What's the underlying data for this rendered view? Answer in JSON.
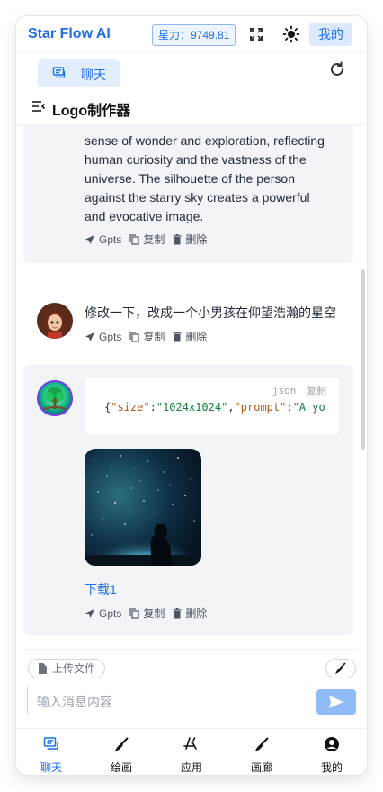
{
  "header": {
    "brand": "Star Flow AI",
    "power": "星力：9749.81",
    "mine": "我的",
    "icons": [
      "fullscreen-icon",
      "sun-icon"
    ]
  },
  "subbar": {
    "tab_label": "聊天",
    "page_title": "Logo制作器"
  },
  "messages": [
    {
      "role": "bot",
      "lines": [
        "sense of wonder and exploration, reflecting",
        "human curiosity and the vastness of the",
        "universe. The silhouette of the person",
        "against the starry sky creates a powerful",
        "and evocative image."
      ],
      "actions": [
        "Gpts",
        "复制",
        "删除"
      ]
    },
    {
      "role": "user",
      "text": "修改一下，改成一个小男孩在仰望浩瀚的星空",
      "actions": [
        "Gpts",
        "复制",
        "删除"
      ]
    },
    {
      "role": "bot",
      "code_lang": "json",
      "code_copy": "复制",
      "code_key1": "\"size\"",
      "code_val1": "\"1024x1024\"",
      "code_key2": "\"prompt\"",
      "code_val2": "\"A yo",
      "download": "下载1",
      "actions": [
        "Gpts",
        "复制",
        "删除"
      ]
    }
  ],
  "composer": {
    "upload_label": "上传文件",
    "placeholder": "输入消息内容"
  },
  "bottom_nav": [
    {
      "label": "聊天",
      "icon": "chat-icon",
      "active": true
    },
    {
      "label": "绘画",
      "icon": "brush-icon"
    },
    {
      "label": "应用",
      "icon": "apps-icon"
    },
    {
      "label": "画廊",
      "icon": "gallery-icon"
    },
    {
      "label": "我的",
      "icon": "user-icon"
    }
  ],
  "colors": {
    "accent": "#1d6fe8",
    "bot_bg": "#f2f4f7",
    "send": "#8fbbf7"
  }
}
